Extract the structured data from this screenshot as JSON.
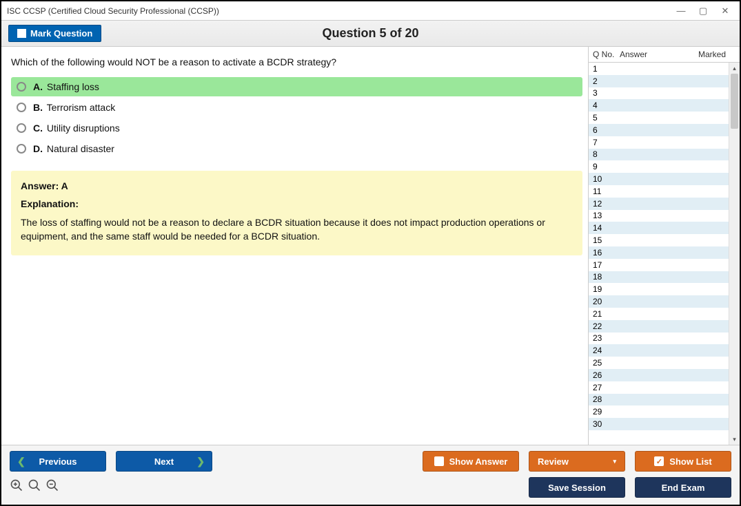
{
  "window": {
    "title": "ISC CCSP (Certified Cloud Security Professional (CCSP))"
  },
  "toolbar": {
    "mark_label": "Mark Question",
    "question_counter": "Question 5 of 20"
  },
  "question": {
    "text": "Which of the following would NOT be a reason to activate a BCDR strategy?",
    "options": [
      {
        "letter": "A.",
        "text": "Staffing loss",
        "highlighted": true
      },
      {
        "letter": "B.",
        "text": "Terrorism attack",
        "highlighted": false
      },
      {
        "letter": "C.",
        "text": "Utility disruptions",
        "highlighted": false
      },
      {
        "letter": "D.",
        "text": "Natural disaster",
        "highlighted": false
      }
    ]
  },
  "answer_panel": {
    "answer_label": "Answer: A",
    "explanation_label": "Explanation:",
    "explanation_text": "The loss of staffing would not be a reason to declare a BCDR situation because it does not impact production operations or equipment, and the same staff would be needed for a BCDR situation."
  },
  "sidebar": {
    "headers": {
      "qno": "Q No.",
      "answer": "Answer",
      "marked": "Marked"
    },
    "row_count": 30
  },
  "footer": {
    "previous": "Previous",
    "next": "Next",
    "show_answer": "Show Answer",
    "review": "Review",
    "show_list": "Show List",
    "save_session": "Save Session",
    "end_exam": "End Exam"
  }
}
